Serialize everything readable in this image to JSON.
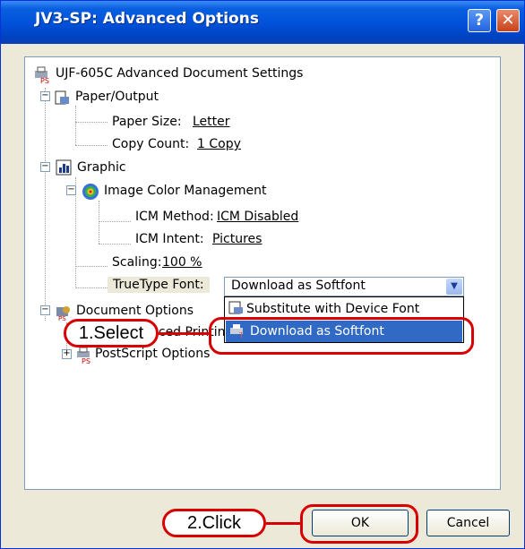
{
  "window": {
    "title": "JV3-SP: Advanced Options",
    "help_glyph": "?",
    "close_glyph": "✕"
  },
  "tree": {
    "root_label": "UJF-605C Advanced Document Settings",
    "paper_output": {
      "label": "Paper/Output",
      "paper_size_label": "Paper Size:",
      "paper_size_value": "Letter",
      "copy_count_label": "Copy Count:",
      "copy_count_value": "1 Copy"
    },
    "graphic": {
      "label": "Graphic",
      "icm": {
        "label": "Image Color Management",
        "method_label": "ICM Method:",
        "method_value": "ICM Disabled",
        "intent_label": "ICM Intent:",
        "intent_value": "Pictures"
      },
      "scaling_label": "Scaling:",
      "scaling_value": "100 %",
      "truetype_label": "TrueType Font:"
    },
    "document_options": {
      "label": "Document Options",
      "advanced_printing_partial": "nced Printing"
    },
    "postscript_options": {
      "label": "PostScript Options"
    }
  },
  "truetype_combo": {
    "selected": "Download as Softfont",
    "options": [
      "Substitute with Device Font",
      "Download as Softfont"
    ]
  },
  "annotations": {
    "select": "1.Select",
    "click": "2.Click"
  },
  "buttons": {
    "ok": "OK",
    "cancel": "Cancel"
  },
  "colors": {
    "titlebar": "#0050d8",
    "selection": "#316ac5",
    "callout_red": "#d80000",
    "dialog_bg": "#ece9d8"
  }
}
